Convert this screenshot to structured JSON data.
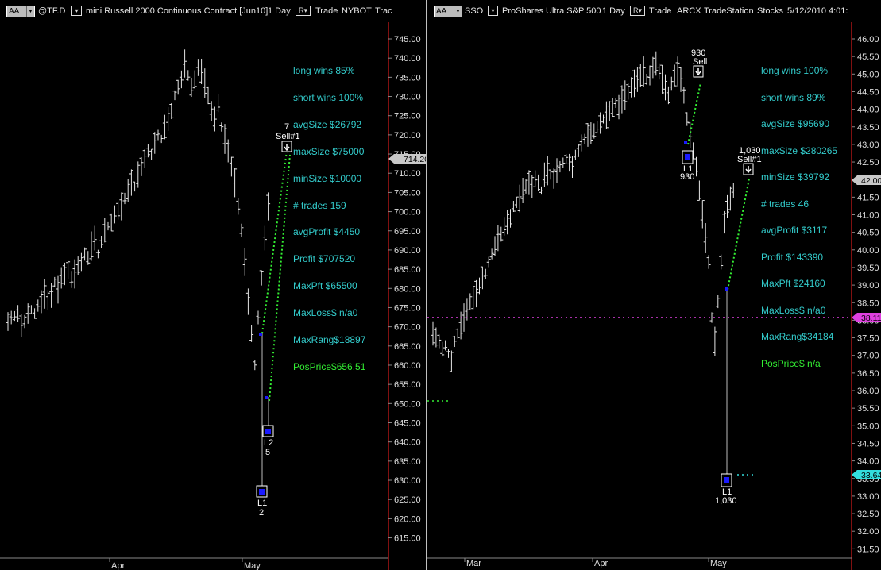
{
  "left": {
    "title": {
      "aa": "AA",
      "symbol": "@TF.D",
      "description": "mini Russell 2000 Continuous Contract [Jun10]",
      "interval": "1 Day",
      "data_mode": "R",
      "type": "Trade",
      "exchange": "NYBOT",
      "trailing": "Trac"
    },
    "stats": [
      {
        "text": "long wins 85%",
        "color": "cyan"
      },
      {
        "text": "short wins 100%",
        "color": "cyan"
      },
      {
        "text": "avgSize $26792",
        "color": "cyan"
      },
      {
        "text": "maxSize $75000",
        "color": "cyan"
      },
      {
        "text": "minSize $10000",
        "color": "cyan"
      },
      {
        "text": "# trades 159",
        "color": "cyan"
      },
      {
        "text": "avgProfit $4450",
        "color": "cyan"
      },
      {
        "text": "Profit $707520",
        "color": "cyan"
      },
      {
        "text": "MaxPft $65500",
        "color": "cyan"
      },
      {
        "text": "MaxLoss$ n/a0",
        "color": "cyan"
      },
      {
        "text": "MaxRang$18897",
        "color": "cyan"
      },
      {
        "text": "PosPrice$656.51",
        "color": "green"
      }
    ],
    "price_axis": {
      "labels": [
        "745.00",
        "740.00",
        "735.00",
        "730.00",
        "725.00",
        "720.00",
        "715.00",
        "710.00",
        "705.00",
        "700.00",
        "695.00",
        "690.00",
        "685.00",
        "680.00",
        "675.00",
        "670.00",
        "665.00",
        "660.00",
        "655.00",
        "650.00",
        "645.00",
        "640.00",
        "635.00",
        "630.00",
        "625.00",
        "620.00",
        "615.00"
      ],
      "last_price": "714.20",
      "last_price_color": "#c8c8c8"
    },
    "month_labels": [
      "Apr",
      "May"
    ],
    "signals": {
      "sell_count": "7",
      "sell_label": "Sell#1",
      "l2_label": "L2",
      "l2_count": "5",
      "l1_label": "L1",
      "l1_count": "2"
    }
  },
  "right": {
    "title": {
      "aa": "AA",
      "symbol": "SSO",
      "description": "ProShares Ultra S&P 500",
      "interval": "1 Day",
      "data_mode": "R",
      "type": "Trade",
      "exchange": "ARCX",
      "source": "TradeStation",
      "category": "Stocks",
      "datetime": "5/12/2010 4:01:"
    },
    "stats": [
      {
        "text": "long wins 100%",
        "color": "cyan"
      },
      {
        "text": "short wins 89%",
        "color": "cyan"
      },
      {
        "text": "avgSize $95690",
        "color": "cyan"
      },
      {
        "text": "maxSize $280265",
        "color": "cyan"
      },
      {
        "text": "minSize $39792",
        "color": "cyan"
      },
      {
        "text": "# trades 46",
        "color": "cyan"
      },
      {
        "text": "avgProfit $3117",
        "color": "cyan"
      },
      {
        "text": "Profit $143390",
        "color": "cyan"
      },
      {
        "text": "MaxPft $24160",
        "color": "cyan"
      },
      {
        "text": "MaxLoss$ n/a0",
        "color": "cyan"
      },
      {
        "text": "MaxRang$34184",
        "color": "cyan"
      },
      {
        "text": "PosPrice$ n/a",
        "color": "green"
      }
    ],
    "price_axis": {
      "labels": [
        "46.00",
        "45.50",
        "45.00",
        "44.50",
        "44.00",
        "43.50",
        "43.00",
        "42.50",
        "42.00",
        "41.50",
        "41.00",
        "40.50",
        "40.00",
        "39.50",
        "39.00",
        "38.50",
        "38.00",
        "37.50",
        "37.00",
        "36.50",
        "36.00",
        "35.50",
        "35.00",
        "34.50",
        "34.00",
        "33.50",
        "33.00",
        "32.50",
        "32.00",
        "31.50"
      ],
      "last_price": "42.00",
      "markers": [
        {
          "value": "38.11",
          "color": "#e040e0"
        },
        {
          "value": "33.64",
          "color": "#33dddd"
        }
      ]
    },
    "month_labels": [
      "Mar",
      "Apr",
      "May"
    ],
    "signals": {
      "sell1_count": "930",
      "sell1_label": "Sell",
      "l1a_label": "L1",
      "l1a_count": "930",
      "sell2_count": "1,030",
      "sell2_label": "Sell#1",
      "l1b_label": "L1",
      "l1b_count": "1,030"
    }
  },
  "colors": {
    "background": "#000000",
    "bars": "#e6e6e6",
    "stat_cyan": "#33cccc",
    "stat_green": "#33ee33",
    "trend_line": "#33ee33",
    "horizontal_level": "#e040e0",
    "axis_line": "#ff2020",
    "entry_marker": "#1a1aff"
  }
}
